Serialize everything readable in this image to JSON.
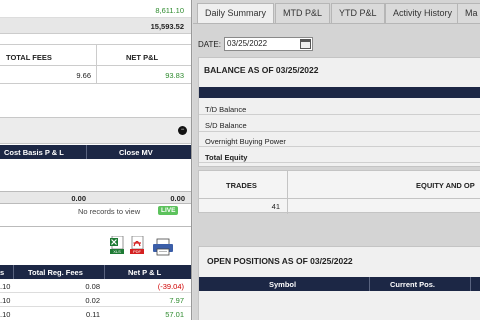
{
  "left": {
    "top_values": [
      "8,611.10",
      "15,593.52"
    ],
    "fees_table": {
      "headers": [
        "TOTAL FEES",
        "NET P&L"
      ],
      "values": [
        "9.66",
        "93.83"
      ]
    },
    "positions_panel": {
      "headers": [
        "Cost Basis P & L",
        "Close MV"
      ],
      "total": "0.00",
      "total2": "0.00",
      "empty_text": "No records to view",
      "live_label": "LIVE"
    },
    "trades_panel": {
      "headers": [
        "s",
        "Total Reg. Fees",
        "Net P & L"
      ],
      "rows": [
        {
          "a": ".10",
          "fees": "0.08",
          "net": "(-39.04)",
          "neg": true
        },
        {
          "a": ".10",
          "fees": "0.02",
          "net": "7.97",
          "neg": false
        },
        {
          "a": ".10",
          "fees": "0.11",
          "net": "57.01",
          "neg": false
        }
      ]
    }
  },
  "right": {
    "tabs": [
      "Daily Summary",
      "MTD P&L",
      "YTD P&L",
      "Activity History",
      "Ma"
    ],
    "date_label": "DATE:",
    "date_value": "03/25/2022",
    "balance_title": "BALANCE AS OF 03/25/2022",
    "balance_items": [
      "T/D Balance",
      "S/D Balance",
      "Overnight Buying Power",
      "Total Equity"
    ],
    "trades_header": "TRADES",
    "equity_header": "EQUITY AND OP",
    "trades_value": "41",
    "open_positions_title": "OPEN POSITIONS AS OF 03/25/2022",
    "open_positions_headers": [
      "Symbol",
      "Current Pos."
    ]
  },
  "icons": [
    "minus-circle-icon",
    "excel-icon",
    "pdf-icon",
    "printer-icon",
    "calendar-icon"
  ],
  "colors": {
    "navy": "#1c2745",
    "green": "#2e8b2e",
    "red": "#d00000",
    "live": "#5cc25c"
  }
}
